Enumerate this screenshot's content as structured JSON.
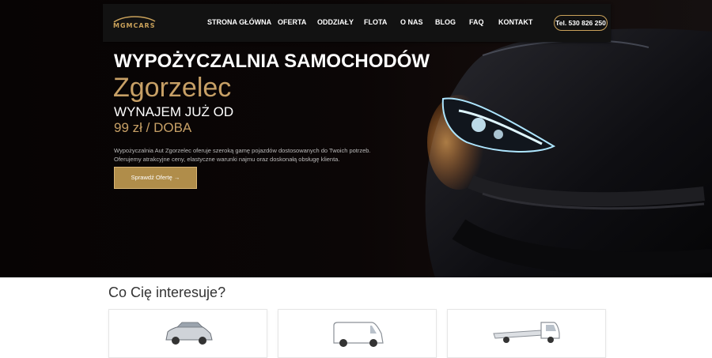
{
  "brand": {
    "logo_text": "MGMCARS",
    "accent": "#c7a066"
  },
  "nav": {
    "items": [
      {
        "label": "STRONA GŁÓWNA"
      },
      {
        "label": "OFERTA"
      },
      {
        "label": "ODDZIAŁY"
      },
      {
        "label": "FLOTA"
      },
      {
        "label": "O NAS"
      },
      {
        "label": "BLOG"
      },
      {
        "label": "FAQ"
      },
      {
        "label": "KONTAKT"
      }
    ],
    "phone": "Tel. 530 826 250"
  },
  "hero": {
    "title": "WYPOŻYCZALNIA SAMOCHODÓW",
    "city": "Zgorzelec",
    "rent_line": "WYNAJEM JUŻ OD",
    "price_line": "99 zł / DOBA",
    "description_line1": "Wypożyczalnia Aut Zgorzelec oferuje szeroką gamę pojazdów dostosowanych do Twoich potrzeb.",
    "description_line2": "Oferujemy atrakcyjne ceny, elastyczne warunki najmu oraz doskonałą obsługę klienta.",
    "cta_label": "Sprawdź Ofertę →"
  },
  "interests": {
    "title": "Co Cię interesuje?",
    "cards": [
      {
        "icon": "suv-car-icon"
      },
      {
        "icon": "van-icon"
      },
      {
        "icon": "tow-truck-icon"
      }
    ]
  }
}
